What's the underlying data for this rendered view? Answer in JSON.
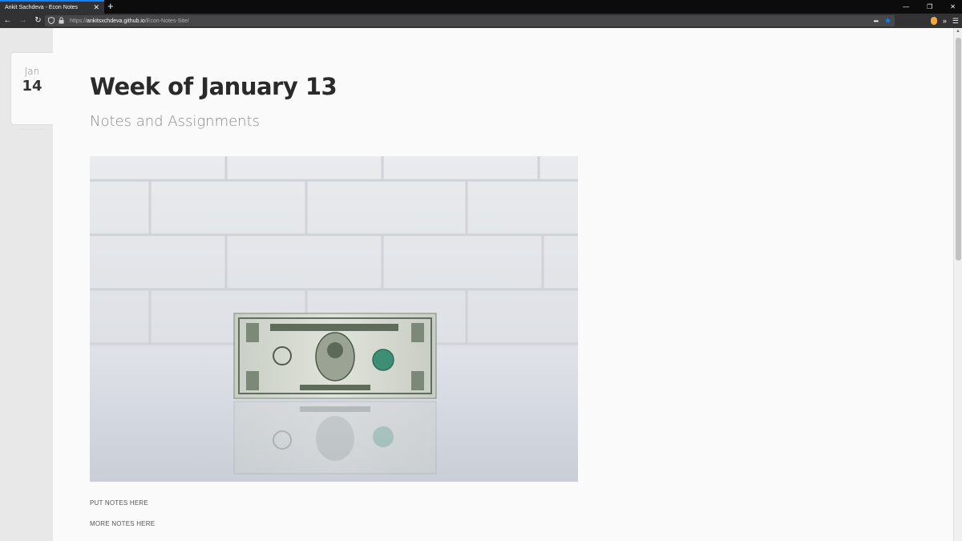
{
  "browser": {
    "tab_title": "Ankit Sachdeva - Econ Notes",
    "tab_close": "✕",
    "new_tab": "+",
    "url_prefix": "https://",
    "url_host": "ankitsxchdeva.github.io",
    "url_path": "/Econ-Notes-Site/",
    "win_minimize": "—",
    "win_restore": "❐",
    "win_close": "✕",
    "back": "←",
    "forward": "→",
    "reload": "↻",
    "page_actions": "•••",
    "bookmark_star": "★",
    "overflow": "»",
    "menu": "☰"
  },
  "post": {
    "date_month": "Jan",
    "date_day": "14",
    "title": "Week of January 13",
    "subtitle": "Notes and Assignments",
    "notes": [
      "PUT NOTES HERE",
      "MORE NOTES HERE"
    ]
  },
  "colors": {
    "accent": "#0a84ff",
    "chrome_dark": "#0c0c0d",
    "chrome_toolbar": "#323234",
    "page_bg": "#fafafa"
  }
}
